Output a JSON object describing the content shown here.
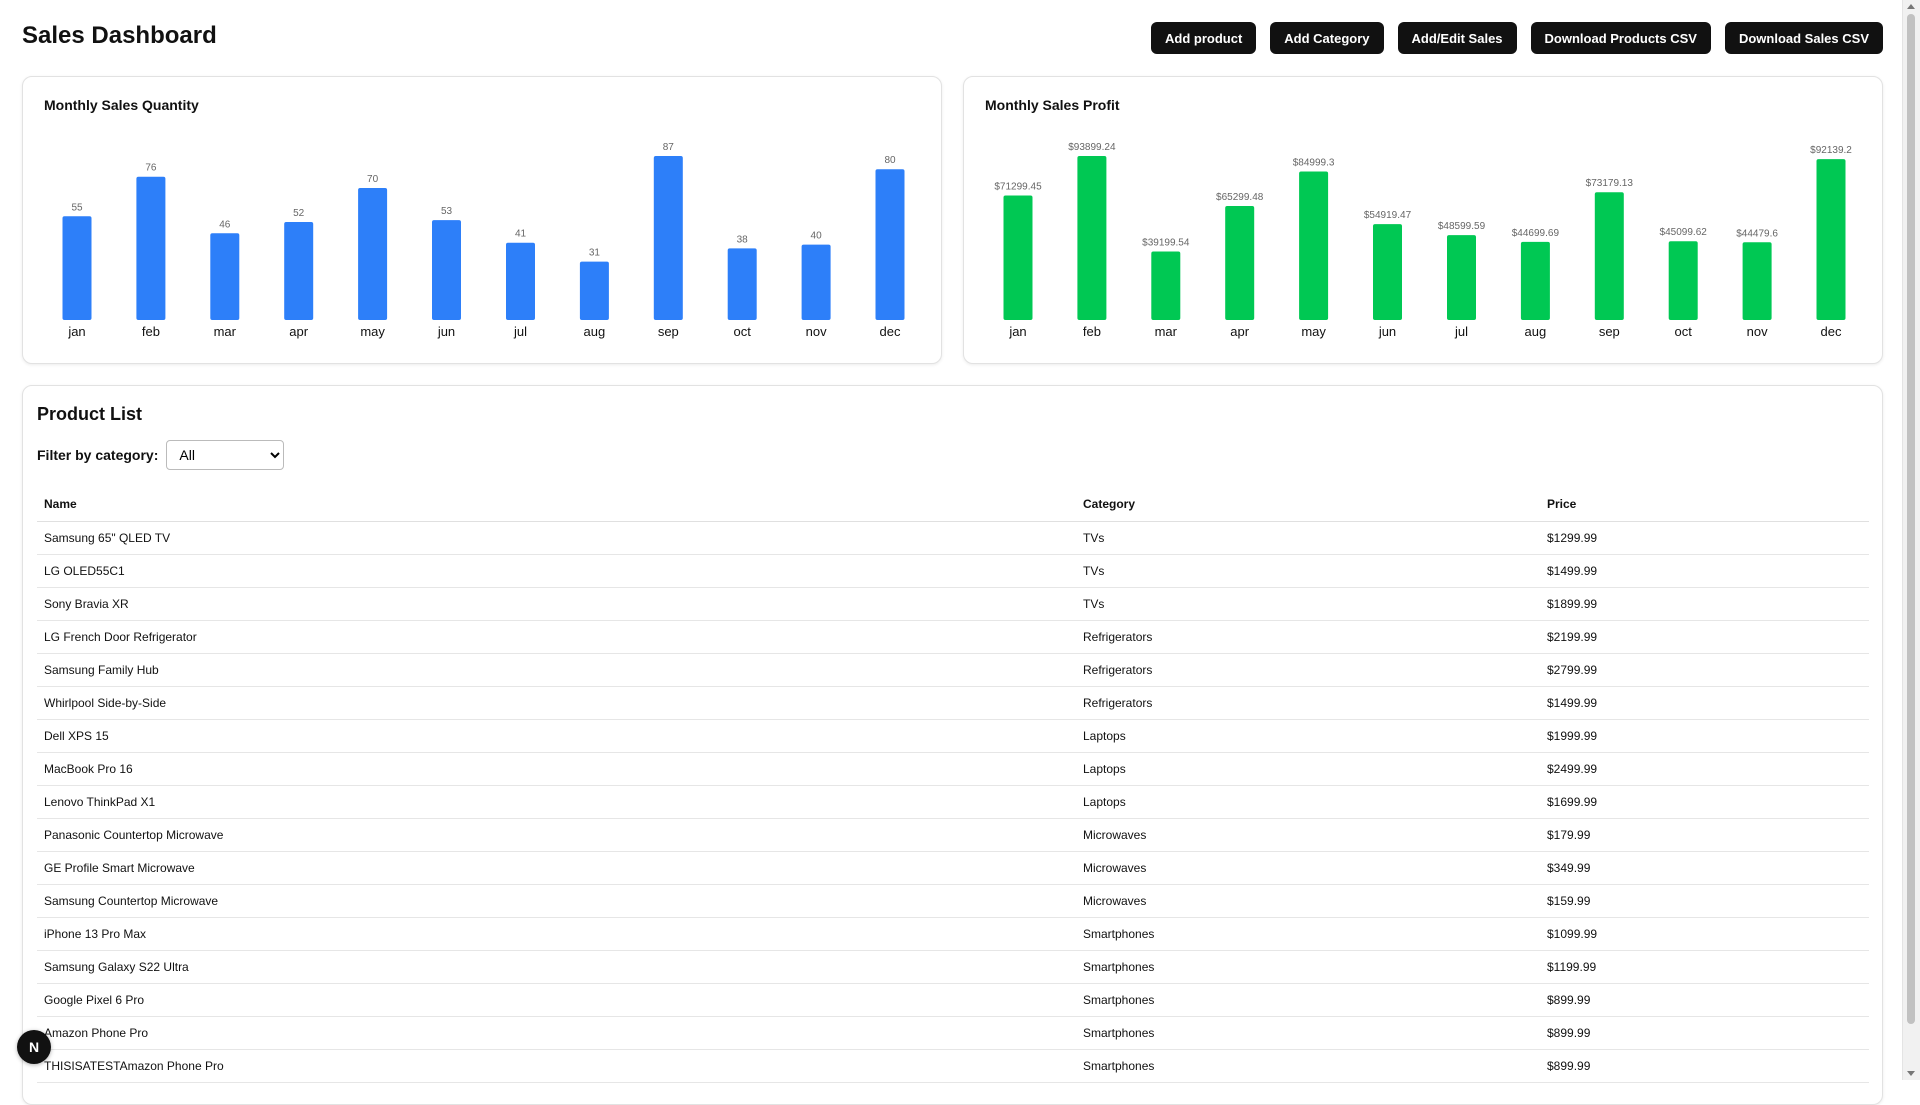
{
  "header": {
    "title": "Sales Dashboard",
    "buttons": [
      "Add product",
      "Add Category",
      "Add/Edit Sales",
      "Download Products CSV",
      "Download Sales CSV"
    ]
  },
  "chart_data": [
    {
      "type": "bar",
      "title": "Monthly Sales Quantity",
      "categories": [
        "jan",
        "feb",
        "mar",
        "apr",
        "may",
        "jun",
        "jul",
        "aug",
        "sep",
        "oct",
        "nov",
        "dec"
      ],
      "values": [
        55,
        76,
        46,
        52,
        70,
        53,
        41,
        31,
        87,
        38,
        40,
        80
      ],
      "labels": [
        "55",
        "76",
        "46",
        "52",
        "70",
        "53",
        "41",
        "31",
        "87",
        "38",
        "40",
        "80"
      ],
      "color": "#2d7ff9"
    },
    {
      "type": "bar",
      "title": "Monthly Sales Profit",
      "categories": [
        "jan",
        "feb",
        "mar",
        "apr",
        "may",
        "jun",
        "jul",
        "aug",
        "sep",
        "oct",
        "nov",
        "dec"
      ],
      "values": [
        71299.45,
        93899.24,
        39199.54,
        65299.48,
        84999.3,
        54919.47,
        48599.59,
        44699.69,
        73179.13,
        45099.62,
        44479.6,
        92139.2
      ],
      "labels": [
        "$71299.45",
        "$93899.24",
        "$39199.54",
        "$65299.48",
        "$84999.3",
        "$54919.47",
        "$48599.59",
        "$44699.69",
        "$73179.13",
        "$45099.62",
        "$44479.6",
        "$92139.2"
      ],
      "color": "#00c853"
    }
  ],
  "products": {
    "title": "Product List",
    "filter_label": "Filter by category:",
    "filter_value": "All",
    "columns": [
      "Name",
      "Category",
      "Price"
    ],
    "rows": [
      [
        "Samsung 65\" QLED TV",
        "TVs",
        "$1299.99"
      ],
      [
        "LG OLED55C1",
        "TVs",
        "$1499.99"
      ],
      [
        "Sony Bravia XR",
        "TVs",
        "$1899.99"
      ],
      [
        "LG French Door Refrigerator",
        "Refrigerators",
        "$2199.99"
      ],
      [
        "Samsung Family Hub",
        "Refrigerators",
        "$2799.99"
      ],
      [
        "Whirlpool Side-by-Side",
        "Refrigerators",
        "$1499.99"
      ],
      [
        "Dell XPS 15",
        "Laptops",
        "$1999.99"
      ],
      [
        "MacBook Pro 16",
        "Laptops",
        "$2499.99"
      ],
      [
        "Lenovo ThinkPad X1",
        "Laptops",
        "$1699.99"
      ],
      [
        "Panasonic Countertop Microwave",
        "Microwaves",
        "$179.99"
      ],
      [
        "GE Profile Smart Microwave",
        "Microwaves",
        "$349.99"
      ],
      [
        "Samsung Countertop Microwave",
        "Microwaves",
        "$159.99"
      ],
      [
        "iPhone 13 Pro Max",
        "Smartphones",
        "$1099.99"
      ],
      [
        "Samsung Galaxy S22 Ultra",
        "Smartphones",
        "$1199.99"
      ],
      [
        "Google Pixel 6 Pro",
        "Smartphones",
        "$899.99"
      ],
      [
        "Amazon Phone Pro",
        "Smartphones",
        "$899.99"
      ],
      [
        "THISISATESTAmazon Phone Pro",
        "Smartphones",
        "$899.99"
      ]
    ]
  },
  "badge": {
    "letter": "N"
  }
}
